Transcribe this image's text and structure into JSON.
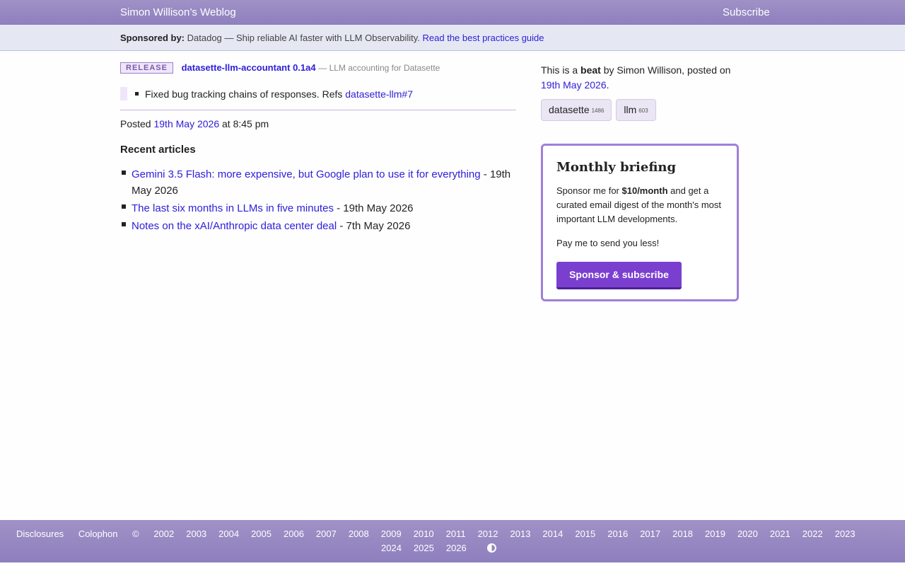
{
  "header": {
    "site_title": "Simon Willison’s Weblog",
    "subscribe": "Subscribe"
  },
  "sponsor": {
    "label": "Sponsored by:",
    "text": "Datadog — Ship reliable AI faster with LLM Observability.",
    "link": "Read the best practices guide"
  },
  "release": {
    "badge": "RELEASE",
    "name": "datasette-llm-accountant 0.1a4",
    "description": "— LLM accounting for Datasette"
  },
  "notes": {
    "item_text": "Fixed bug tracking chains of responses. Refs",
    "item_link": "datasette-llm#7"
  },
  "posted": {
    "prefix": "Posted",
    "date": "19th May 2026",
    "time": "at 8:45 pm"
  },
  "recent": {
    "title": "Recent articles",
    "items": [
      {
        "title": "Gemini 3.5 Flash: more expensive, but Google plan to use it for everything",
        "date_first": " -",
        "date_second": "19th May 2026"
      },
      {
        "title": "The last six months in LLMs in five minutes",
        "date": " - 19th May 2026"
      },
      {
        "title": "Notes on the xAI/Anthropic data center deal",
        "date": " - 7th May 2026"
      }
    ]
  },
  "sidebar": {
    "beat_prefix": "This is a",
    "beat_word": "beat",
    "beat_suffix": "by Simon Willison, posted on",
    "beat_date": "19th May 2026",
    "beat_end": ".",
    "tags": [
      {
        "name": "datasette",
        "count": "1486"
      },
      {
        "name": "llm",
        "count": "603"
      }
    ]
  },
  "briefing": {
    "title": "Monthly briefing",
    "desc_prefix": "Sponsor me for",
    "desc_price": "$10/month",
    "desc_suffix": "and get a curated email digest of the month's most important LLM developments.",
    "pay_less": "Pay me to send you less!",
    "button": "Sponsor & subscribe"
  },
  "footer": {
    "disclosures": "Disclosures",
    "colophon": "Colophon",
    "copyright": "©",
    "years_row1": [
      "2002",
      "2003",
      "2004",
      "2005",
      "2006",
      "2007",
      "2008",
      "2009",
      "2010",
      "2011",
      "2012",
      "2013",
      "2014",
      "2015",
      "2016",
      "2017",
      "2018",
      "2019",
      "2020",
      "2021",
      "2022",
      "2023"
    ],
    "years_row2": [
      "2024",
      "2025",
      "2026"
    ],
    "theme_toggle_icon": "contrast-icon"
  }
}
